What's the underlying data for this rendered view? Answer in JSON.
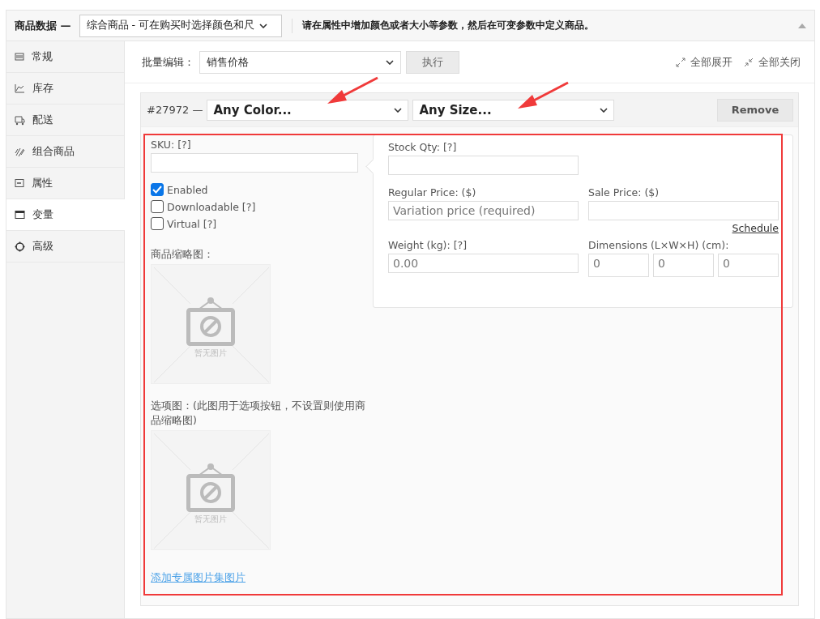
{
  "header": {
    "title": "商品数据 —",
    "product_type": "综合商品 - 可在购买时选择颜色和尺",
    "notice": "请在属性中增加颜色或者大小等参数，然后在可变参数中定义商品。"
  },
  "sidebar": {
    "items": [
      {
        "label": "常规",
        "selected": false
      },
      {
        "label": "库存",
        "selected": false
      },
      {
        "label": "配送",
        "selected": false
      },
      {
        "label": "组合商品",
        "selected": false
      },
      {
        "label": "属性",
        "selected": false
      },
      {
        "label": "变量",
        "selected": true
      },
      {
        "label": "高级",
        "selected": false
      }
    ]
  },
  "toolbar": {
    "bulk_label": "批量编辑：",
    "bulk_value": "销售价格",
    "apply_button": "执行",
    "expand_all": "全部展开",
    "close_all": "全部关闭"
  },
  "variation": {
    "id": "#27972 —",
    "attributes": [
      {
        "value": "Any Color..."
      },
      {
        "value": "Any Size..."
      }
    ],
    "remove_button": "Remove",
    "sku": {
      "label": "SKU: [?]"
    },
    "checkboxes": [
      {
        "label": "Enabled",
        "checked": true
      },
      {
        "label": "Downloadable [?]",
        "checked": false
      },
      {
        "label": "Virtual [?]",
        "checked": false
      }
    ],
    "images": [
      {
        "label": "商品缩略图：",
        "caption": "暂无图片"
      },
      {
        "label": "选项图：(此图用于选项按钮，不设置则使用商品缩略图)",
        "caption": "暂无图片"
      }
    ],
    "gallery_link": "添加专属图片集图片",
    "stock": {
      "label": "Stock Qty: [?]"
    },
    "regular_price": {
      "label": "Regular Price: ($)",
      "placeholder": "Variation price (required)"
    },
    "sale_price": {
      "label": "Sale Price: ($)"
    },
    "schedule_link": "Schedule",
    "weight": {
      "label": "Weight (kg): [?]",
      "placeholder": "0.00"
    },
    "dimensions": {
      "label": "Dimensions (L×W×H) (cm):",
      "fields": [
        {
          "placeholder": "0"
        },
        {
          "placeholder": "0"
        },
        {
          "placeholder": "0"
        }
      ]
    }
  }
}
